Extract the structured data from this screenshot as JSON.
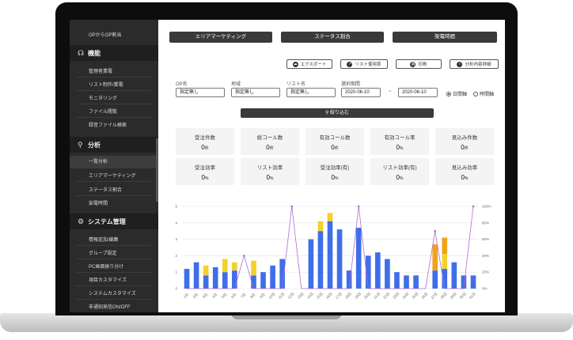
{
  "sidebar": {
    "top_item": "OPからOP割当",
    "section1": {
      "label": "機能",
      "icon": "headset-icon",
      "items": [
        "管理者業電",
        "リスト制作/業電",
        "モニタリング",
        "ファイル閲覧",
        "録音ファイル検索"
      ]
    },
    "section2": {
      "label": "分析",
      "icon": "search-icon",
      "items": [
        "一覧分析",
        "エリアマーケティング",
        "ステータス割合",
        "架電時間"
      ]
    },
    "section3": {
      "label": "システム管理",
      "icon": "gear-icon",
      "items": [
        "情報追加/編集",
        "グループ設定",
        "PC画面振り分け",
        "項目カスタマイズ",
        "システムカスタマイズ",
        "非通知発信ON/OFF"
      ]
    }
  },
  "nav_buttons": [
    "エリアマーケティング",
    "ステータス割合",
    "架電時間"
  ],
  "action_buttons": [
    {
      "label": "エクスポート",
      "icon": "cloud-icon"
    },
    {
      "label": "リスト使用率",
      "icon": "external-link-icon"
    },
    {
      "label": "印刷",
      "icon": "print-icon"
    },
    {
      "label": "分析内容詳細",
      "icon": "info-icon"
    }
  ],
  "filters": {
    "op": {
      "label": "OP名",
      "value": "指定無し"
    },
    "area": {
      "label": "地域",
      "value": "指定無し"
    },
    "list": {
      "label": "リスト名",
      "value": "指定無し"
    },
    "period": {
      "label": "選択期間",
      "from": "2020-06-10",
      "sep": "~",
      "to": "2020-06-10"
    },
    "radio_day": "日間軸",
    "radio_time": "時間軸"
  },
  "search_button": "絞り込む",
  "stats": [
    {
      "label": "受注件数",
      "value": "0",
      "unit": "件"
    },
    {
      "label": "総コール数",
      "value": "0",
      "unit": "件"
    },
    {
      "label": "有効コール数",
      "value": "0",
      "unit": "件"
    },
    {
      "label": "有効コール率",
      "value": "0",
      "unit": "%"
    },
    {
      "label": "見込み件数",
      "value": "0",
      "unit": "件"
    },
    {
      "label": "受注効率",
      "value": "0",
      "unit": "%"
    },
    {
      "label": "リスト効率",
      "value": "0",
      "unit": "%"
    },
    {
      "label": "受注効率(有)",
      "value": "0",
      "unit": "%"
    },
    {
      "label": "リスト効率(有)",
      "value": "0",
      "unit": "%"
    },
    {
      "label": "見込み効率",
      "value": "0",
      "unit": "%"
    }
  ],
  "colors": {
    "blue": "#3f6ee8",
    "yellow": "#f2d22a",
    "orange": "#f0a21c",
    "line": "#b16ad4"
  },
  "chart_data": {
    "type": "bar",
    "categories": [
      "1日",
      "2日",
      "3日",
      "4日",
      "5日",
      "6日",
      "7日",
      "8日",
      "9日",
      "10日",
      "11日",
      "12日",
      "13日",
      "14日",
      "15日",
      "16日",
      "17日",
      "18日",
      "19日",
      "20日",
      "21日",
      "22日",
      "23日",
      "24日",
      "25日",
      "26日",
      "27日",
      "28日",
      "29日",
      "30日",
      "31日"
    ],
    "series": [
      {
        "values": [
          1.2,
          1.6,
          0.8,
          1.3,
          1.0,
          1.1,
          0,
          0.8,
          1.0,
          1.4,
          1.8,
          0,
          0,
          3.0,
          3.5,
          4.1,
          3.6,
          1.1,
          3.7,
          2.0,
          2.2,
          1.8,
          1.0,
          0.8,
          0.8,
          0,
          1.1,
          1.2,
          1.6,
          0.8,
          0.8
        ]
      },
      {
        "values": [
          0,
          0,
          0.6,
          0,
          0.8,
          0.5,
          0,
          0.9,
          0,
          0,
          0,
          0,
          0,
          0,
          0.6,
          0.5,
          0,
          0,
          0,
          0,
          0,
          0,
          0,
          0,
          0,
          0,
          0,
          0.9,
          0,
          0,
          0
        ]
      },
      {
        "values": [
          0,
          0,
          0,
          0,
          0,
          0,
          0,
          0,
          0,
          0,
          0,
          0,
          0,
          0,
          0,
          0,
          0,
          0,
          0,
          0,
          0,
          0,
          0,
          0,
          0,
          0,
          1.6,
          1.0,
          0,
          0,
          0
        ]
      }
    ],
    "line": [
      0,
      0,
      0,
      0,
      0,
      0,
      40,
      0,
      0,
      0,
      0,
      100,
      0,
      0,
      0,
      0,
      0,
      0,
      100,
      0,
      0,
      0,
      0,
      0,
      0,
      0,
      70,
      0,
      0,
      0,
      100
    ],
    "ylim": [
      0,
      5
    ],
    "y2lim": [
      0,
      100
    ]
  }
}
